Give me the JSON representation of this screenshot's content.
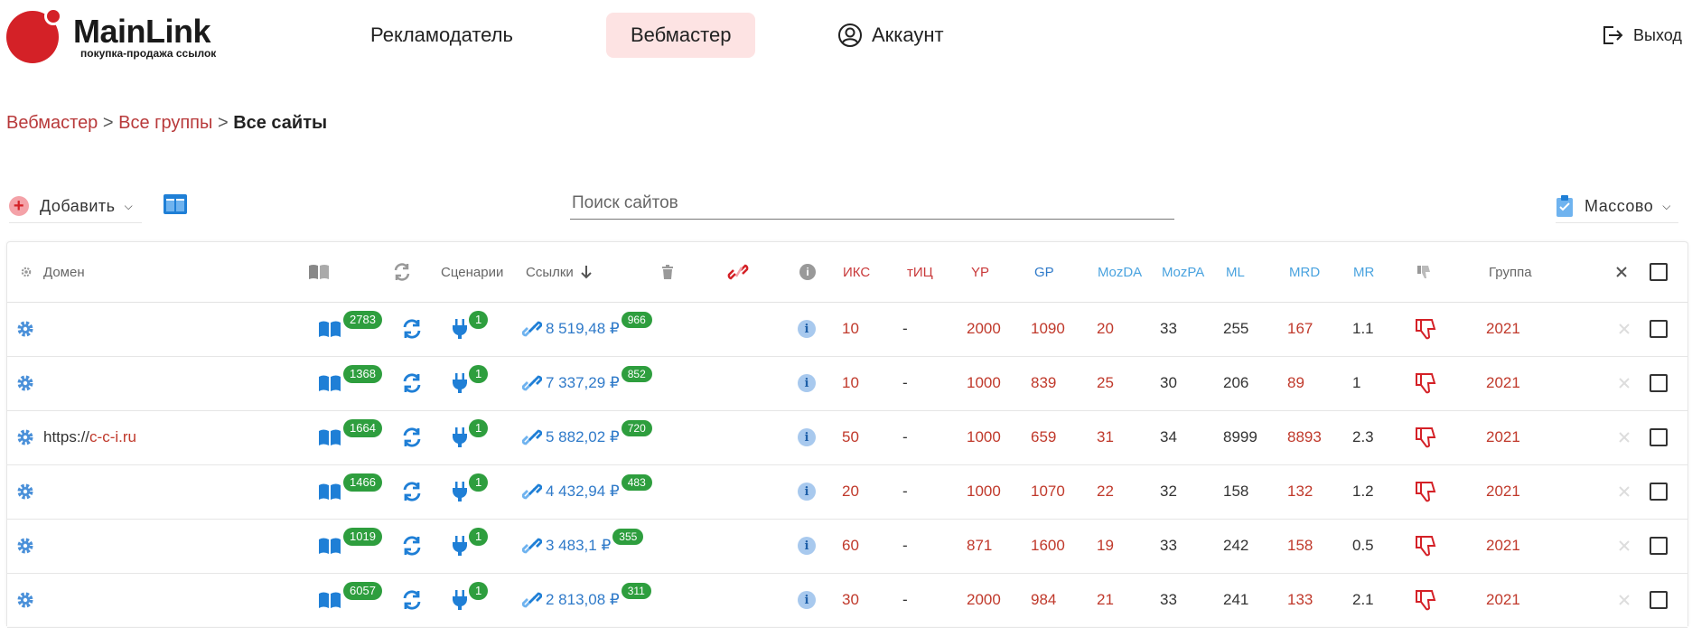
{
  "header": {
    "logo_name": "MainLink",
    "logo_tagline": "покупка-продажа ссылок",
    "nav": {
      "advertiser": "Рекламодатель",
      "webmaster": "Вебмастер",
      "account": "Аккаунт"
    },
    "exit": "Выход"
  },
  "breadcrumb": {
    "item1": "Вебмастер",
    "sep": ">",
    "item2": "Все группы",
    "current": "Все сайты"
  },
  "toolbar": {
    "add_label": "Добавить",
    "search_placeholder": "Поиск сайтов",
    "mass_label": "Массово"
  },
  "table": {
    "headers": {
      "domain": "Домен",
      "scenarios": "Сценарии",
      "links": "Ссылки",
      "iks": "ИКС",
      "tic": "тИЦ",
      "yp": "YP",
      "gp": "GP",
      "mozda": "MozDA",
      "mozpa": "MozPA",
      "ml": "ML",
      "mrd": "MRD",
      "mr": "MR",
      "group": "Группа"
    },
    "rows": [
      {
        "domain_prefix": "",
        "domain_host": "",
        "pages": "2783",
        "scenarios": "1",
        "links_amount": "8 519,48 ₽",
        "links_count": "966",
        "iks": "10",
        "tic": "-",
        "yp": "2000",
        "gp": "1090",
        "mozda": "20",
        "mozpa": "33",
        "ml": "255",
        "mrd": "167",
        "mr": "1.1",
        "group": "2021"
      },
      {
        "domain_prefix": "",
        "domain_host": "",
        "pages": "1368",
        "scenarios": "1",
        "links_amount": "7 337,29 ₽",
        "links_count": "852",
        "iks": "10",
        "tic": "-",
        "yp": "1000",
        "gp": "839",
        "mozda": "25",
        "mozpa": "30",
        "ml": "206",
        "mrd": "89",
        "mr": "1",
        "group": "2021"
      },
      {
        "domain_prefix": "https://",
        "domain_host": "c-c-i.ru",
        "pages": "1664",
        "scenarios": "1",
        "links_amount": "5 882,02 ₽",
        "links_count": "720",
        "iks": "50",
        "tic": "-",
        "yp": "1000",
        "gp": "659",
        "mozda": "31",
        "mozpa": "34",
        "ml": "8999",
        "mrd": "8893",
        "mr": "2.3",
        "group": "2021"
      },
      {
        "domain_prefix": "",
        "domain_host": "",
        "pages": "1466",
        "scenarios": "1",
        "links_amount": "4 432,94 ₽",
        "links_count": "483",
        "iks": "20",
        "tic": "-",
        "yp": "1000",
        "gp": "1070",
        "mozda": "22",
        "mozpa": "32",
        "ml": "158",
        "mrd": "132",
        "mr": "1.2",
        "group": "2021"
      },
      {
        "domain_prefix": "",
        "domain_host": "",
        "pages": "1019",
        "scenarios": "1",
        "links_amount": "3 483,1 ₽",
        "links_count": "355",
        "iks": "60",
        "tic": "-",
        "yp": "871",
        "gp": "1600",
        "mozda": "19",
        "mozpa": "33",
        "ml": "242",
        "mrd": "158",
        "mr": "0.5",
        "group": "2021"
      },
      {
        "domain_prefix": "",
        "domain_host": "",
        "pages": "6057",
        "scenarios": "1",
        "links_amount": "2 813,08 ₽",
        "links_count": "311",
        "iks": "30",
        "tic": "-",
        "yp": "2000",
        "gp": "984",
        "mozda": "21",
        "mozpa": "33",
        "ml": "241",
        "mrd": "133",
        "mr": "2.1",
        "group": "2021"
      }
    ]
  },
  "colors": {
    "brand_red": "#d42127",
    "accent_blue": "#2f7ac9",
    "badge_green": "#2e9e3e",
    "active_tab_bg": "#fde3e3"
  }
}
